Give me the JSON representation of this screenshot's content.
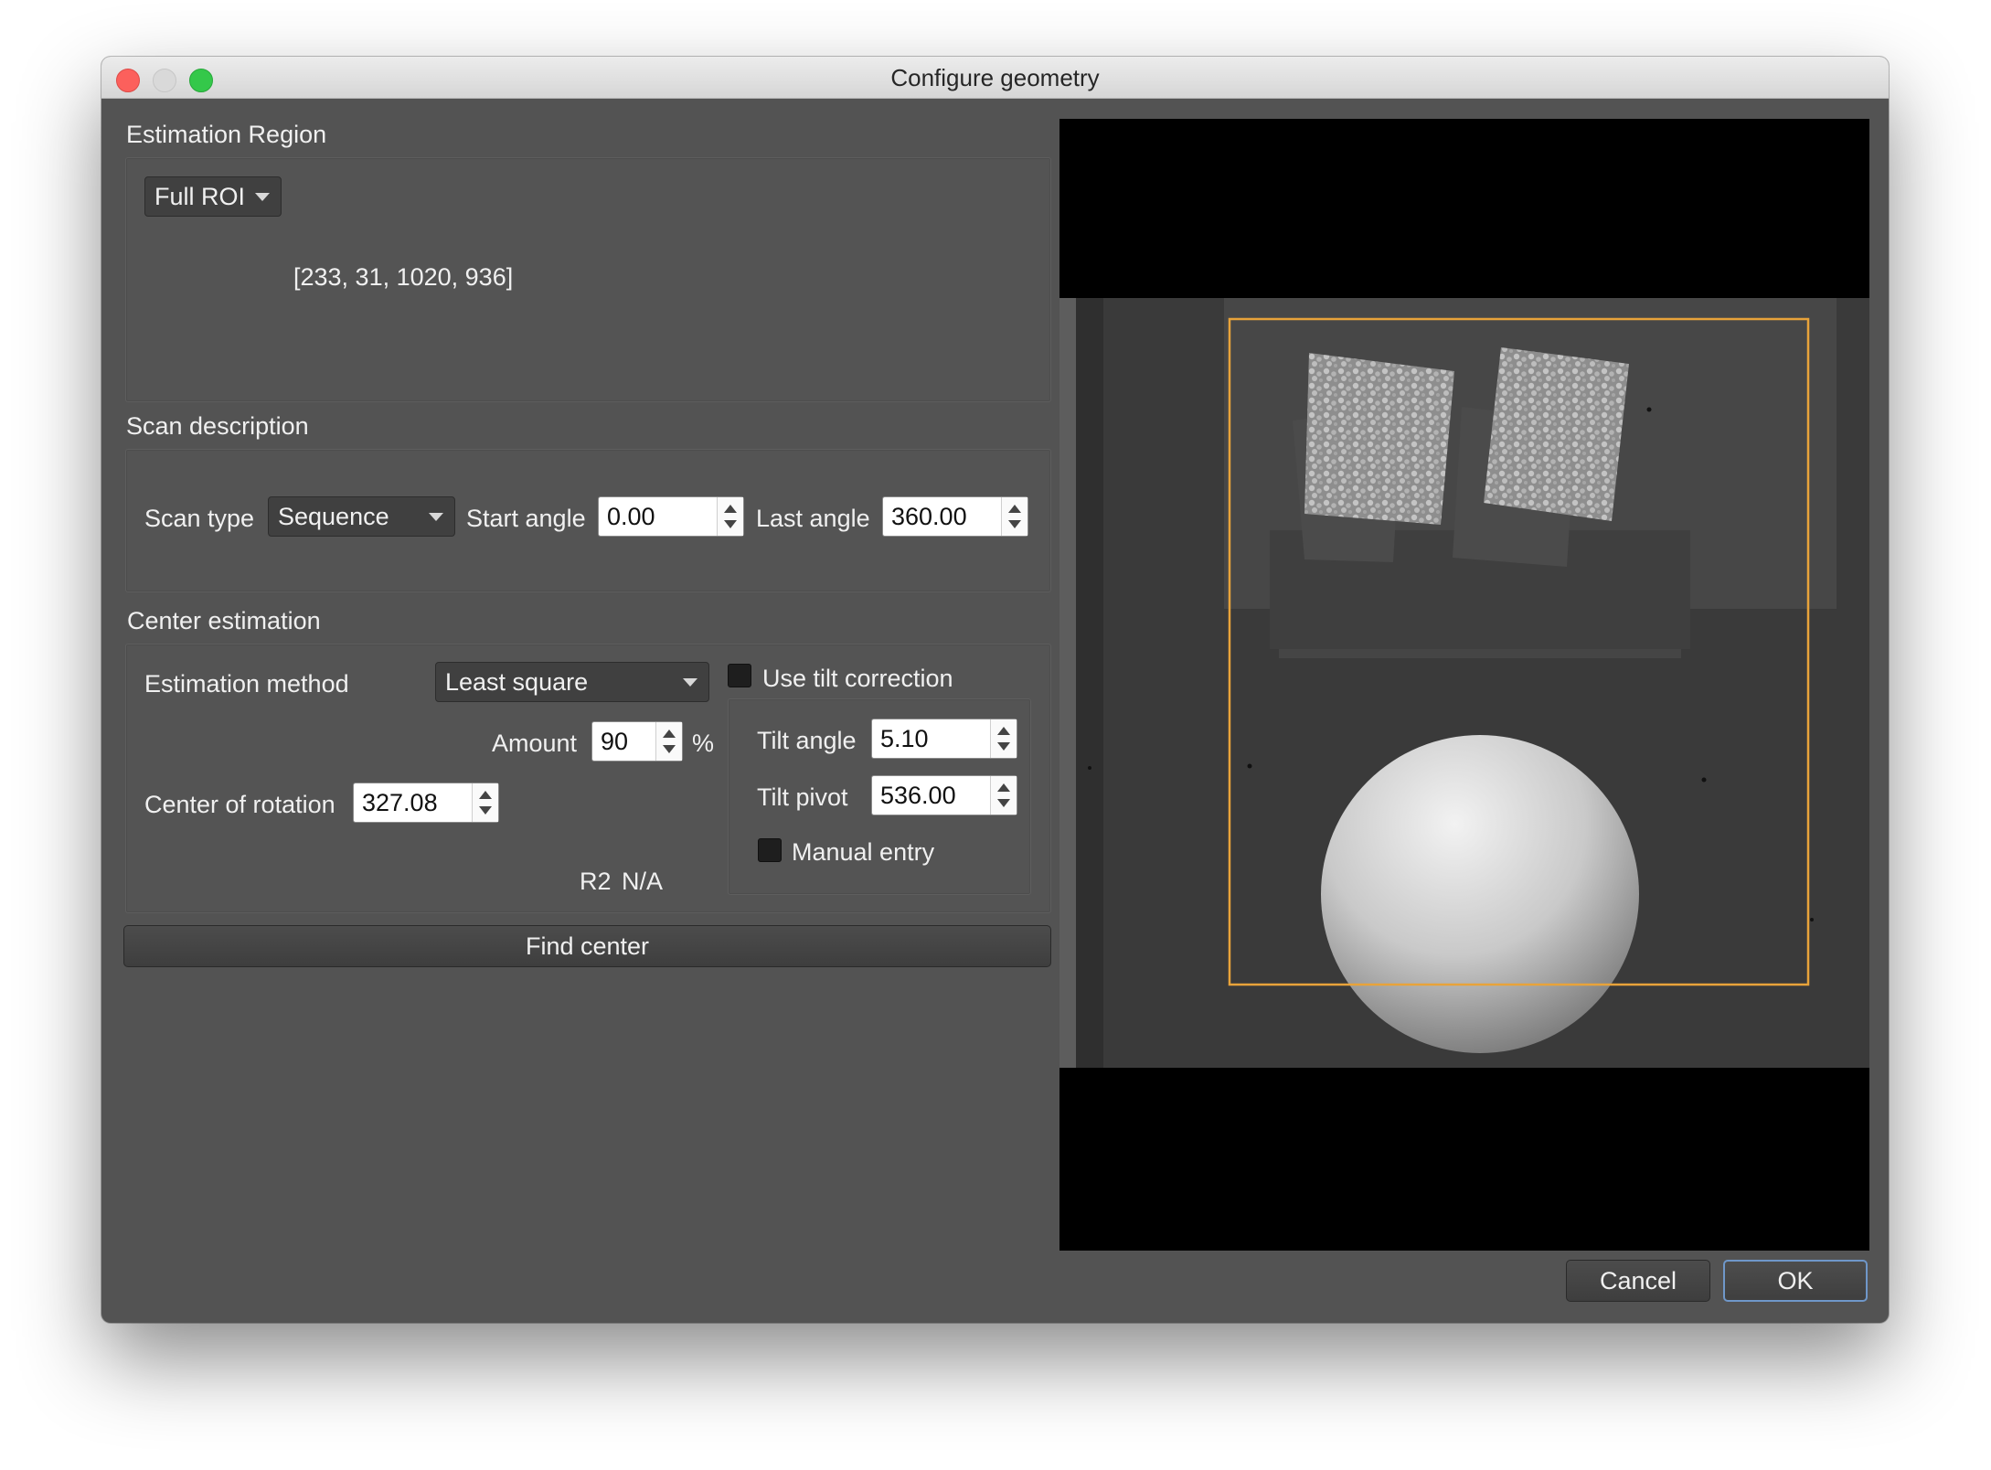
{
  "window": {
    "title": "Configure geometry"
  },
  "estimation_region": {
    "title": "Estimation Region",
    "mode": "Full ROI",
    "roi_values": "[233, 31, 1020, 936]"
  },
  "scan": {
    "title": "Scan description",
    "type_label": "Scan type",
    "type_value": "Sequence",
    "start_label": "Start angle",
    "start_value": "0.00",
    "last_label": "Last angle",
    "last_value": "360.00"
  },
  "center": {
    "title": "Center estimation",
    "method_label": "Estimation method",
    "method_value": "Least square",
    "amount_label": "Amount",
    "amount_value": "90",
    "amount_unit": "%",
    "rotation_label": "Center of rotation",
    "rotation_value": "327.08",
    "r2_label": "R2",
    "r2_value": "N/A",
    "tilt_checkbox_label": "Use tilt correction",
    "tilt_checked": false,
    "tilt_angle_label": "Tilt angle",
    "tilt_angle_value": "5.10",
    "tilt_pivot_label": "Tilt pivot",
    "tilt_pivot_value": "536.00",
    "manual_entry_label": "Manual entry",
    "manual_entry_checked": false
  },
  "actions": {
    "find_center": "Find center",
    "cancel": "Cancel",
    "ok": "OK"
  },
  "colors": {
    "roi_outline": "#e8a33a",
    "dialog_bg": "#535353",
    "ok_border": "#6f97c9"
  }
}
